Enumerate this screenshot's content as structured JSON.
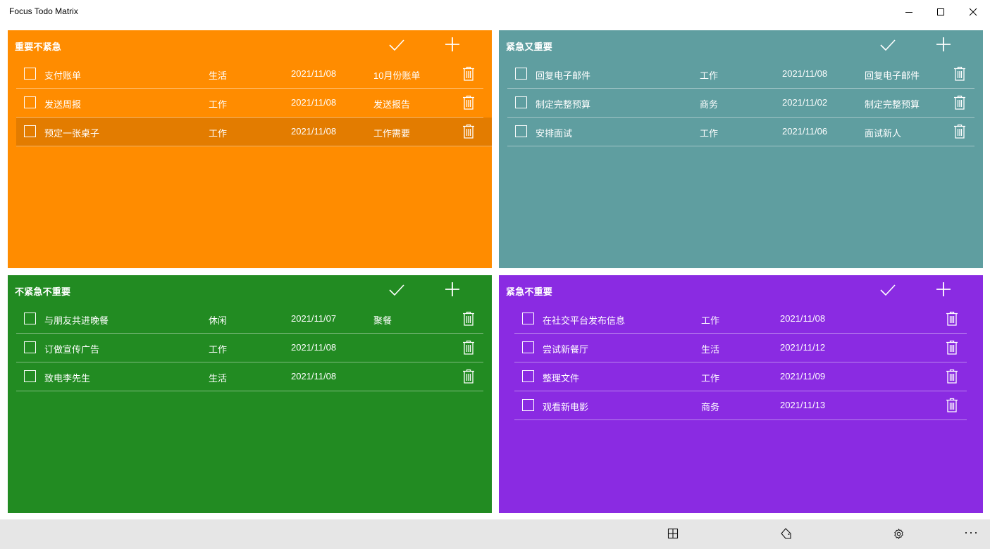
{
  "window": {
    "title": "Focus Todo Matrix"
  },
  "colors": {
    "important_not_urgent": "#FF8C00",
    "urgent_and_important": "#5F9EA0",
    "not_urgent_not_important": "#228B22",
    "urgent_not_important": "#8A2BE2"
  },
  "quadrants": [
    {
      "title": "重要不紧急",
      "tasks": [
        {
          "name": "支付账单",
          "category": "生活",
          "date": "2021/11/08",
          "note": "10月份账单"
        },
        {
          "name": "发送周报",
          "category": "工作",
          "date": "2021/11/08",
          "note": "发送报告"
        },
        {
          "name": "预定一张桌子",
          "category": "工作",
          "date": "2021/11/08",
          "note": "工作需要"
        }
      ]
    },
    {
      "title": "紧急又重要",
      "tasks": [
        {
          "name": "回复电子邮件",
          "category": "工作",
          "date": "2021/11/08",
          "note": "回复电子邮件"
        },
        {
          "name": "制定完整预算",
          "category": "商务",
          "date": "2021/11/02",
          "note": "制定完整预算"
        },
        {
          "name": "安排面试",
          "category": "工作",
          "date": "2021/11/06",
          "note": "面试新人"
        }
      ]
    },
    {
      "title": "不紧急不重要",
      "tasks": [
        {
          "name": "与朋友共进晚餐",
          "category": "休闲",
          "date": "2021/11/07",
          "note": "聚餐"
        },
        {
          "name": "订做宣传广告",
          "category": "工作",
          "date": "2021/11/08",
          "note": ""
        },
        {
          "name": "致电李先生",
          "category": "生活",
          "date": "2021/11/08",
          "note": ""
        }
      ]
    },
    {
      "title": "紧急不重要",
      "tasks": [
        {
          "name": "在社交平台发布信息",
          "category": "工作",
          "date": "2021/11/08",
          "note": ""
        },
        {
          "name": "尝试新餐厅",
          "category": "生活",
          "date": "2021/11/12",
          "note": ""
        },
        {
          "name": "整理文件",
          "category": "工作",
          "date": "2021/11/09",
          "note": ""
        },
        {
          "name": "观看新电影",
          "category": "商务",
          "date": "2021/11/13",
          "note": ""
        }
      ]
    }
  ],
  "bottombar": {
    "icons": [
      "grid-icon",
      "tag-icon",
      "settings-icon",
      "more-icon"
    ],
    "more_label": "···"
  }
}
